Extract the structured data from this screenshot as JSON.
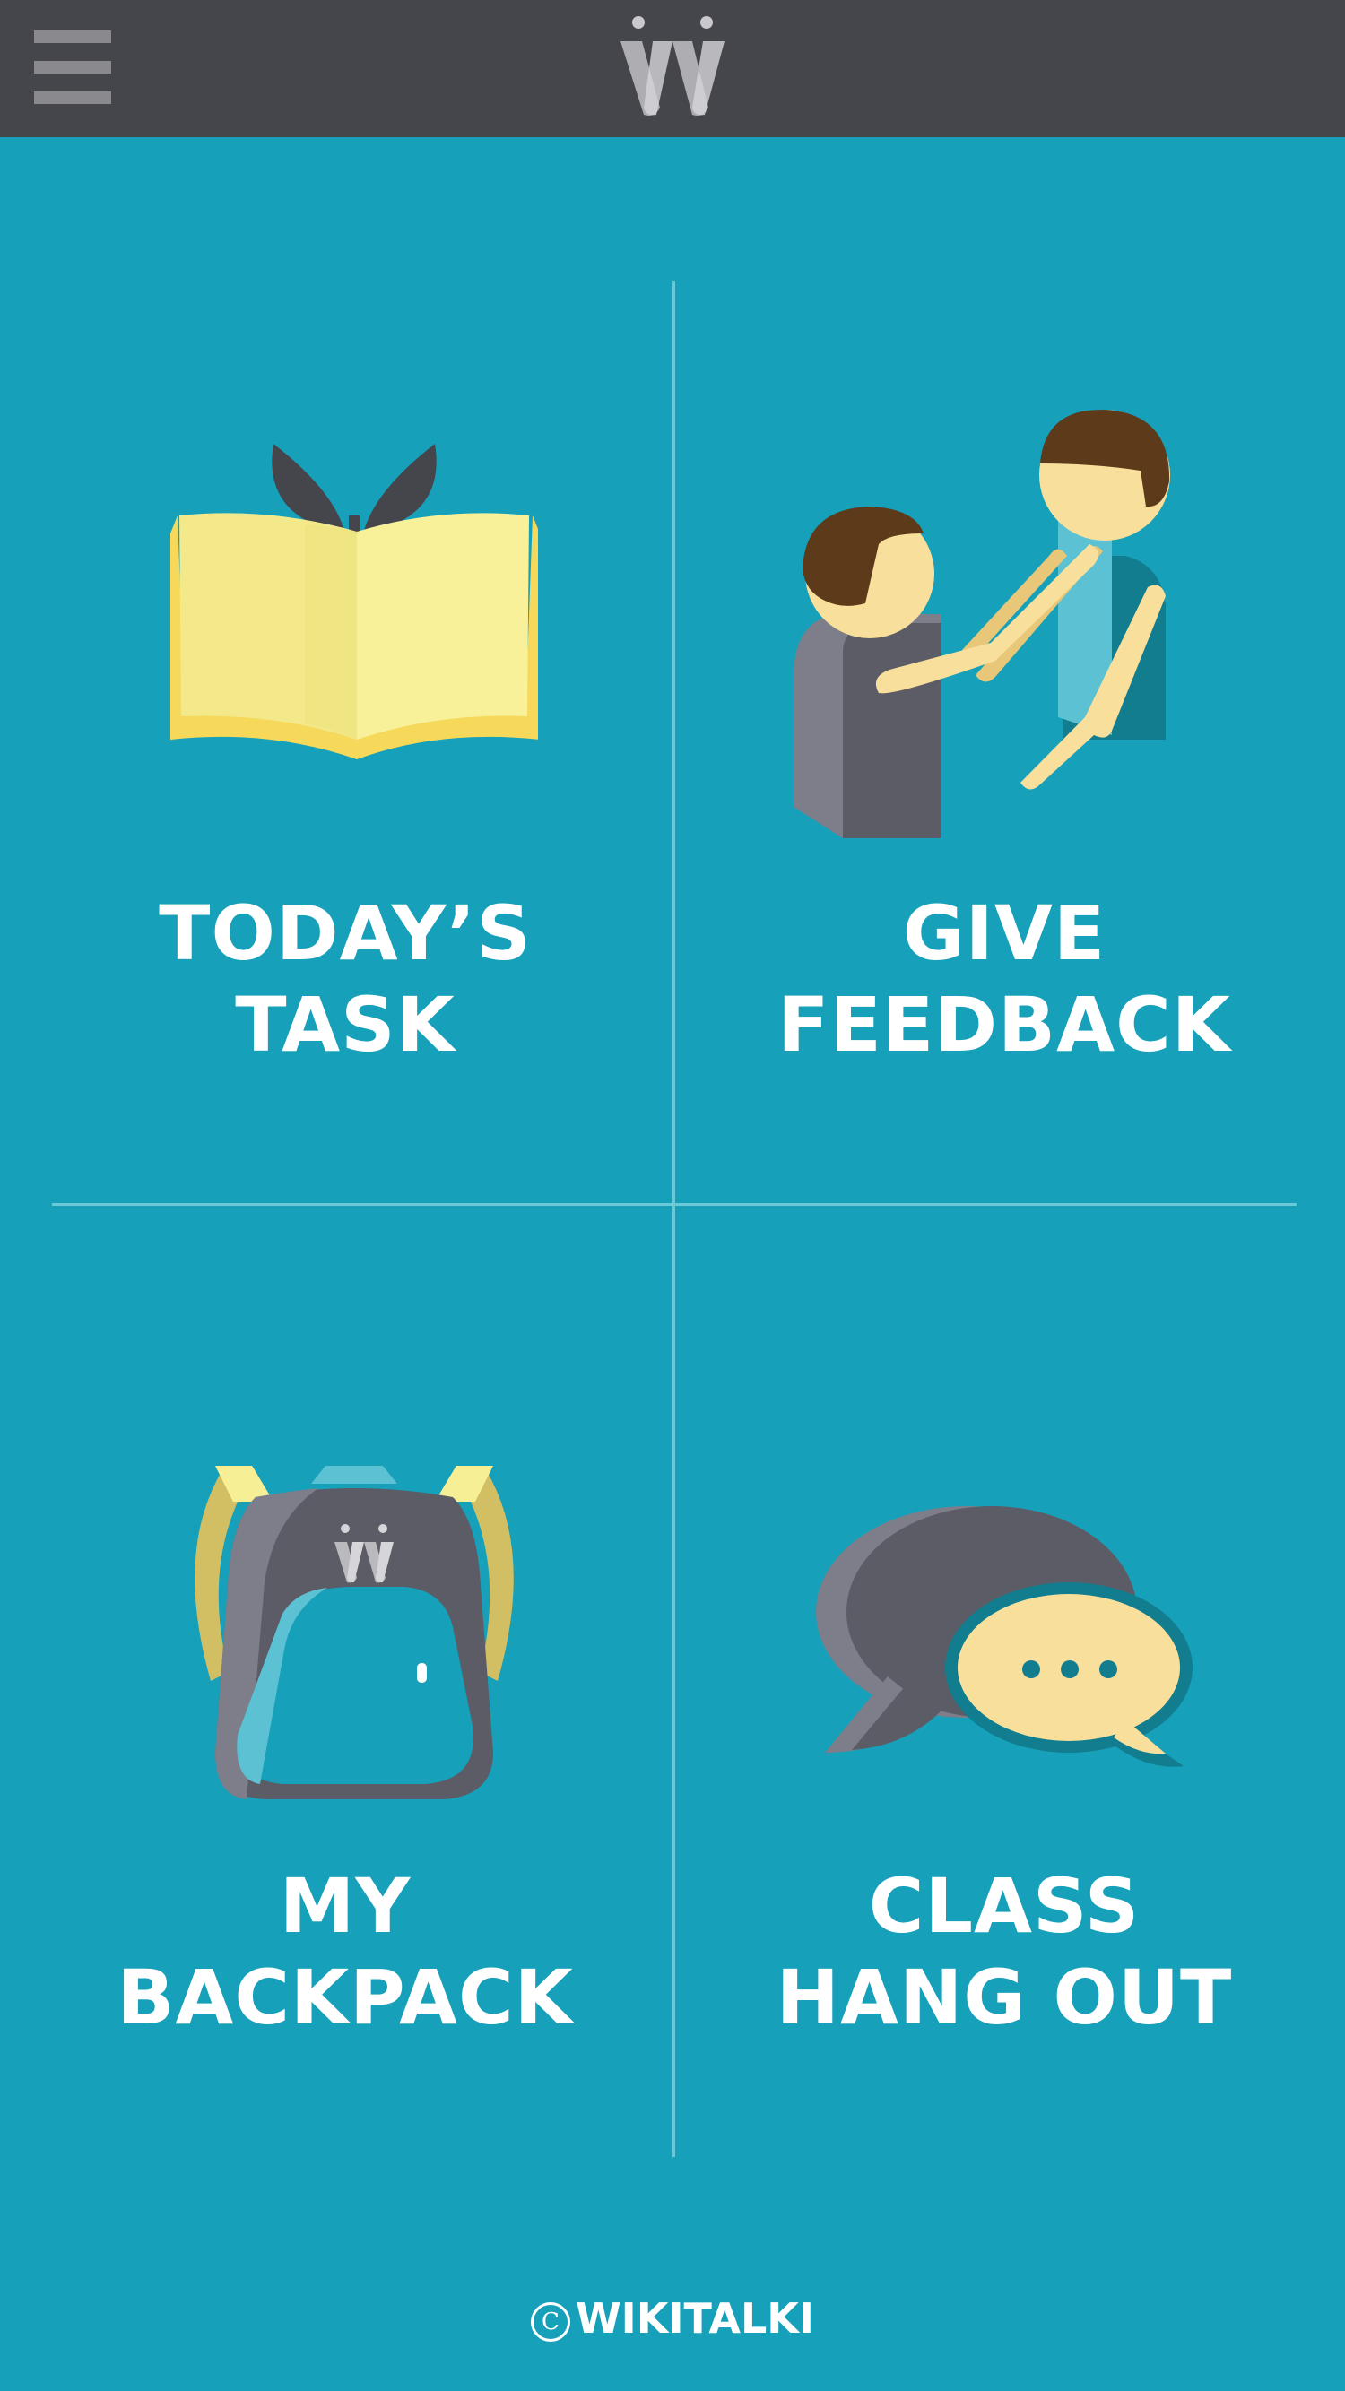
{
  "header": {
    "menu_icon": "hamburger-menu-icon",
    "logo_icon": "wikitalki-w-logo"
  },
  "tiles": [
    {
      "line1": "TODAY’S",
      "line2": "TASK",
      "icon": "open-book-sprout-icon"
    },
    {
      "line1": "GIVE",
      "line2": "FEEDBACK",
      "icon": "people-high-five-icon"
    },
    {
      "line1": "MY",
      "line2": "BACKPACK",
      "icon": "backpack-icon"
    },
    {
      "line1": "CLASS",
      "line2": "HANG OUT",
      "icon": "chat-bubbles-icon"
    }
  ],
  "footer": {
    "copyright_symbol": "C",
    "brand": "WIKITALKI"
  },
  "colors": {
    "background": "#17a0ba",
    "header": "#45454c",
    "divider": "#6cc7d7",
    "label": "#ffffff",
    "book_yellow": "#f7ef96",
    "skin": "#f9df9c",
    "hair": "#5d3a1a",
    "dark_gray": "#5b5c66",
    "teal_dark": "#117d8e"
  }
}
